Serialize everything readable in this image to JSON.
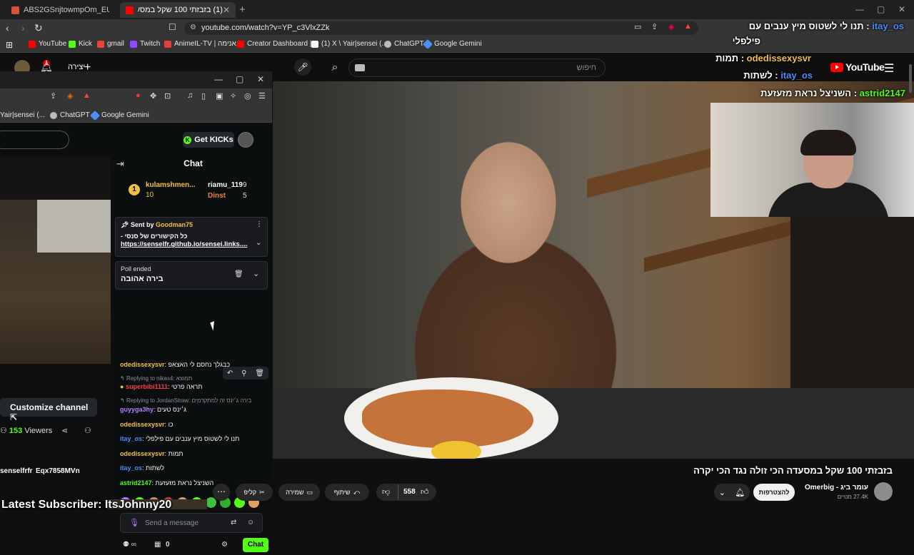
{
  "browser": {
    "tabs": [
      {
        "label": "ABS2GSnjtowmpOm_EUXnj1lxlI6wK...",
        "active": false,
        "icon": "app-icon",
        "color": "#d6533f"
      },
      {
        "label": "(1) בזבזתי 100 שקל במסעדה הכי...",
        "active": true,
        "icon": "youtube-icon",
        "color": "#ff0000"
      }
    ],
    "url": "youtube.com/watch?v=YP_c3VlxZZk",
    "bookmarks": [
      {
        "label": "YouTube",
        "color": "#ff0000"
      },
      {
        "label": "Kick",
        "color": "#53fc18"
      },
      {
        "label": "gmail",
        "color": "#ea4335"
      },
      {
        "label": "Twitch",
        "color": "#9146ff"
      },
      {
        "label": "AnimeIL-TV | אנימה...",
        "color": "#e04040"
      },
      {
        "label": "Creator Dashboard |...",
        "color": "#ff0000"
      },
      {
        "label": "(1) X \\ Yair|sensei (...",
        "color": "#ffffff"
      },
      {
        "label": "ChatGPT",
        "color": "#bbbbbb"
      },
      {
        "label": "Google Gemini",
        "color": "#4c8df6"
      }
    ]
  },
  "youtube": {
    "search_placeholder": "חיפוש",
    "logo": "YouTube",
    "create_label": "יצירה",
    "notification_count": "1",
    "video_title": "בזבזתי 100 שקל במסעדה הכי זולה נגד הכי יקרה",
    "channel_name": "עומר ביג - Omerbig",
    "subscribers": "27.4K מנויים",
    "join_label": "להצטרפות",
    "likes": "558",
    "share_label": "שיתוף",
    "save_label": "שמירה",
    "clip_label": "קליפ"
  },
  "overlay_chat": {
    "messages": [
      {
        "user": "itay_os",
        "user_color": "#4b8df8",
        "text": "תנו לי לשטוס מיץ ענבים עם",
        "text2": "פילפלי"
      },
      {
        "user": "odedissexysvr",
        "user_color": "#f0c040",
        "text": "תמות"
      },
      {
        "user": "itay_os",
        "user_color": "#4b8df8",
        "text": "לשתות"
      },
      {
        "user": "astrid2147",
        "user_color": "#53fc18",
        "text": "השניצל נראת מזעזעת"
      }
    ],
    "latest_subscriber": "Latest Subscriber: ItsJohnny20"
  },
  "nested_browser": {
    "bookmarks": [
      {
        "label": "Yair|sensei (...",
        "color": "#ffffff"
      },
      {
        "label": "ChatGPT",
        "color": "#bbbbbb"
      },
      {
        "label": "Google Gemini",
        "color": "#4c8df6"
      }
    ],
    "get_kicks_label": "Get KICKs",
    "customize_label": "Customize channel",
    "viewers": "153",
    "viewers_label": "Viewers",
    "channel_row": "senselfrfr",
    "channel_row2": "Eqx7858MVn"
  },
  "kick_chat": {
    "title": "Chat",
    "leaderboard": [
      {
        "rank": "1",
        "name": "kulamshmen...",
        "count": "10"
      },
      {
        "name": "riamu_119",
        "count": "9"
      },
      {
        "name": "Dinst",
        "count": "5"
      }
    ],
    "pinned": {
      "sent_by_label": "Sent by",
      "sender": "Goodman75",
      "text": "כל הקישורים של סנסי -",
      "link": "https://senselfr.github.io/sensei.links...."
    },
    "poll": {
      "status": "Poll ended",
      "question": "בירה אהובה"
    },
    "messages": [
      {
        "user": "odedissexysvr",
        "color": "#f0c040",
        "text": "כבגלך נחסם לי האצאפ"
      },
      {
        "reply_to": "Replying to nikas4:",
        "reply_text": "תמוצא"
      },
      {
        "user": "superbibi1111",
        "color": "#ff3b3b",
        "text": "תראה פרטי"
      },
      {
        "reply_to": "Replying to JordanStraw:",
        "reply_text": "בירה ג׳ינס זה למתקדמים"
      },
      {
        "user": "guyyga3hy",
        "color": "#b57cff",
        "text": "ג׳ינס טעים"
      },
      {
        "user": "odedissexysvr",
        "color": "#f0c040",
        "text": "כו"
      },
      {
        "user": "itay_os",
        "color": "#4b8df8",
        "text": "תנו לי לשטוס מיץ ענבים עם פילפלי"
      },
      {
        "user": "odedissexysvr",
        "color": "#f0c040",
        "text": "תמות"
      },
      {
        "user": "itay_os",
        "color": "#4b8df8",
        "text": "לשתות"
      },
      {
        "user": "astrid2147",
        "color": "#53fc18",
        "text": "השניצל נראת מזעזעת"
      }
    ],
    "send_placeholder": "Send a message",
    "points": "0",
    "chat_button": "Chat"
  }
}
